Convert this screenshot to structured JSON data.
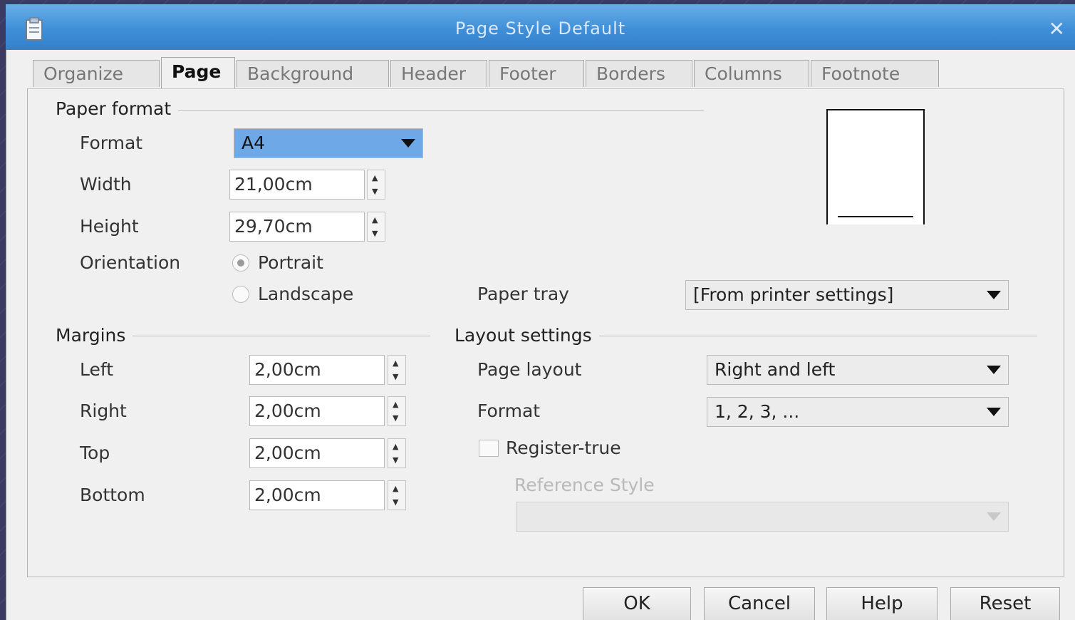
{
  "window": {
    "title": "Page Style  Default",
    "close_icon": "close-icon",
    "app_icon": "document-icon"
  },
  "tabs": [
    {
      "label": "Organize"
    },
    {
      "label": "Page",
      "active": true
    },
    {
      "label": "Background"
    },
    {
      "label": "Header"
    },
    {
      "label": "Footer"
    },
    {
      "label": "Borders"
    },
    {
      "label": "Columns"
    },
    {
      "label": "Footnote"
    }
  ],
  "paper_format": {
    "heading": "Paper format",
    "format_label": "Format",
    "format_value": "A4",
    "width_label": "Width",
    "width_value": "21,00cm",
    "height_label": "Height",
    "height_value": "29,70cm",
    "orientation_label": "Orientation",
    "portrait_label": "Portrait",
    "landscape_label": "Landscape",
    "orientation_selected": "Portrait",
    "paper_tray_label": "Paper tray",
    "paper_tray_value": "[From printer settings]"
  },
  "margins": {
    "heading": "Margins",
    "left_label": "Left",
    "left_value": "2,00cm",
    "right_label": "Right",
    "right_value": "2,00cm",
    "top_label": "Top",
    "top_value": "2,00cm",
    "bottom_label": "Bottom",
    "bottom_value": "2,00cm"
  },
  "layout": {
    "heading": "Layout settings",
    "page_layout_label": "Page layout",
    "page_layout_value": "Right and left",
    "format_label": "Format",
    "format_value": "1, 2, 3, ...",
    "register_true_label": "Register-true",
    "reference_style_label": "Reference Style",
    "reference_style_value": ""
  },
  "buttons": {
    "ok": "OK",
    "cancel": "Cancel",
    "help": "Help",
    "reset": "Reset"
  }
}
